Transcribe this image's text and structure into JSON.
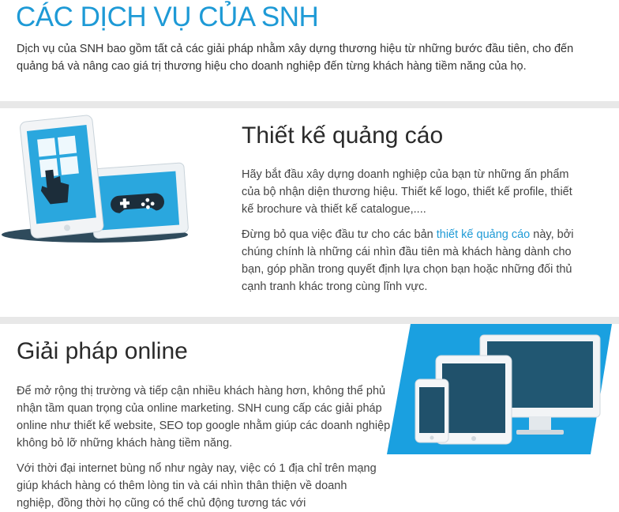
{
  "page": {
    "title": "CÁC DỊCH VỤ CỦA SNH",
    "intro": "Dịch vụ của SNH bao gồm tất cả các giải pháp nhằm xây dựng thương hiệu từ những bước đầu tiên, cho đến quảng bá và nâng cao giá trị thương hiệu cho doanh nghiệp đến từng khách hàng tiềm năng của họ."
  },
  "sections": [
    {
      "title": "Thiết kế quảng cáo",
      "illustration_icon": "tablet-gamepad-icon",
      "p1": "Hãy bắt đầu xây dựng doanh nghiệp của bạn từ những ấn phẩm của bộ nhận diện thương hiệu. Thiết kế logo, thiết kế profile, thiết kế brochure và thiết kế catalogue,....",
      "p2_before": "Đừng bỏ qua việc đầu tư cho các bản ",
      "p2_link": "thiết kế quảng cáo",
      "p2_after": " này, bởi chúng chính là những cái nhìn đầu tiên mà khách hàng dành cho bạn, góp phần trong quyết định lựa chọn bạn hoặc những đối thủ cạnh tranh khác trong cùng lĩnh vực."
    },
    {
      "title": "Giải pháp online",
      "illustration_icon": "responsive-devices-icon",
      "p1": "Để mở rộng thị trường và tiếp cận nhiều khách hàng hơn, không thể phủ nhận tầm quan trọng của online marketing. SNH cung cấp các giải pháp online như thiết kế website, SEO top google nhằm giúp các doanh nghiệp không bỏ lỡ những khách hàng tiềm năng.",
      "p2": "Với thời đại internet bùng nổ như ngày nay, việc có 1 địa chỉ trên mạng giúp khách hàng có thêm lòng tin và cái nhìn thân thiện về doanh nghiệp, đồng thời họ cũng có thể chủ động tương tác với"
    }
  ],
  "colors": {
    "accent": "#1e9ad6",
    "band": "#e8e8e8",
    "device_blue": "#2aa7de",
    "screen_dark": "#1f6e94",
    "panel_blue": "#1aa0e0"
  }
}
